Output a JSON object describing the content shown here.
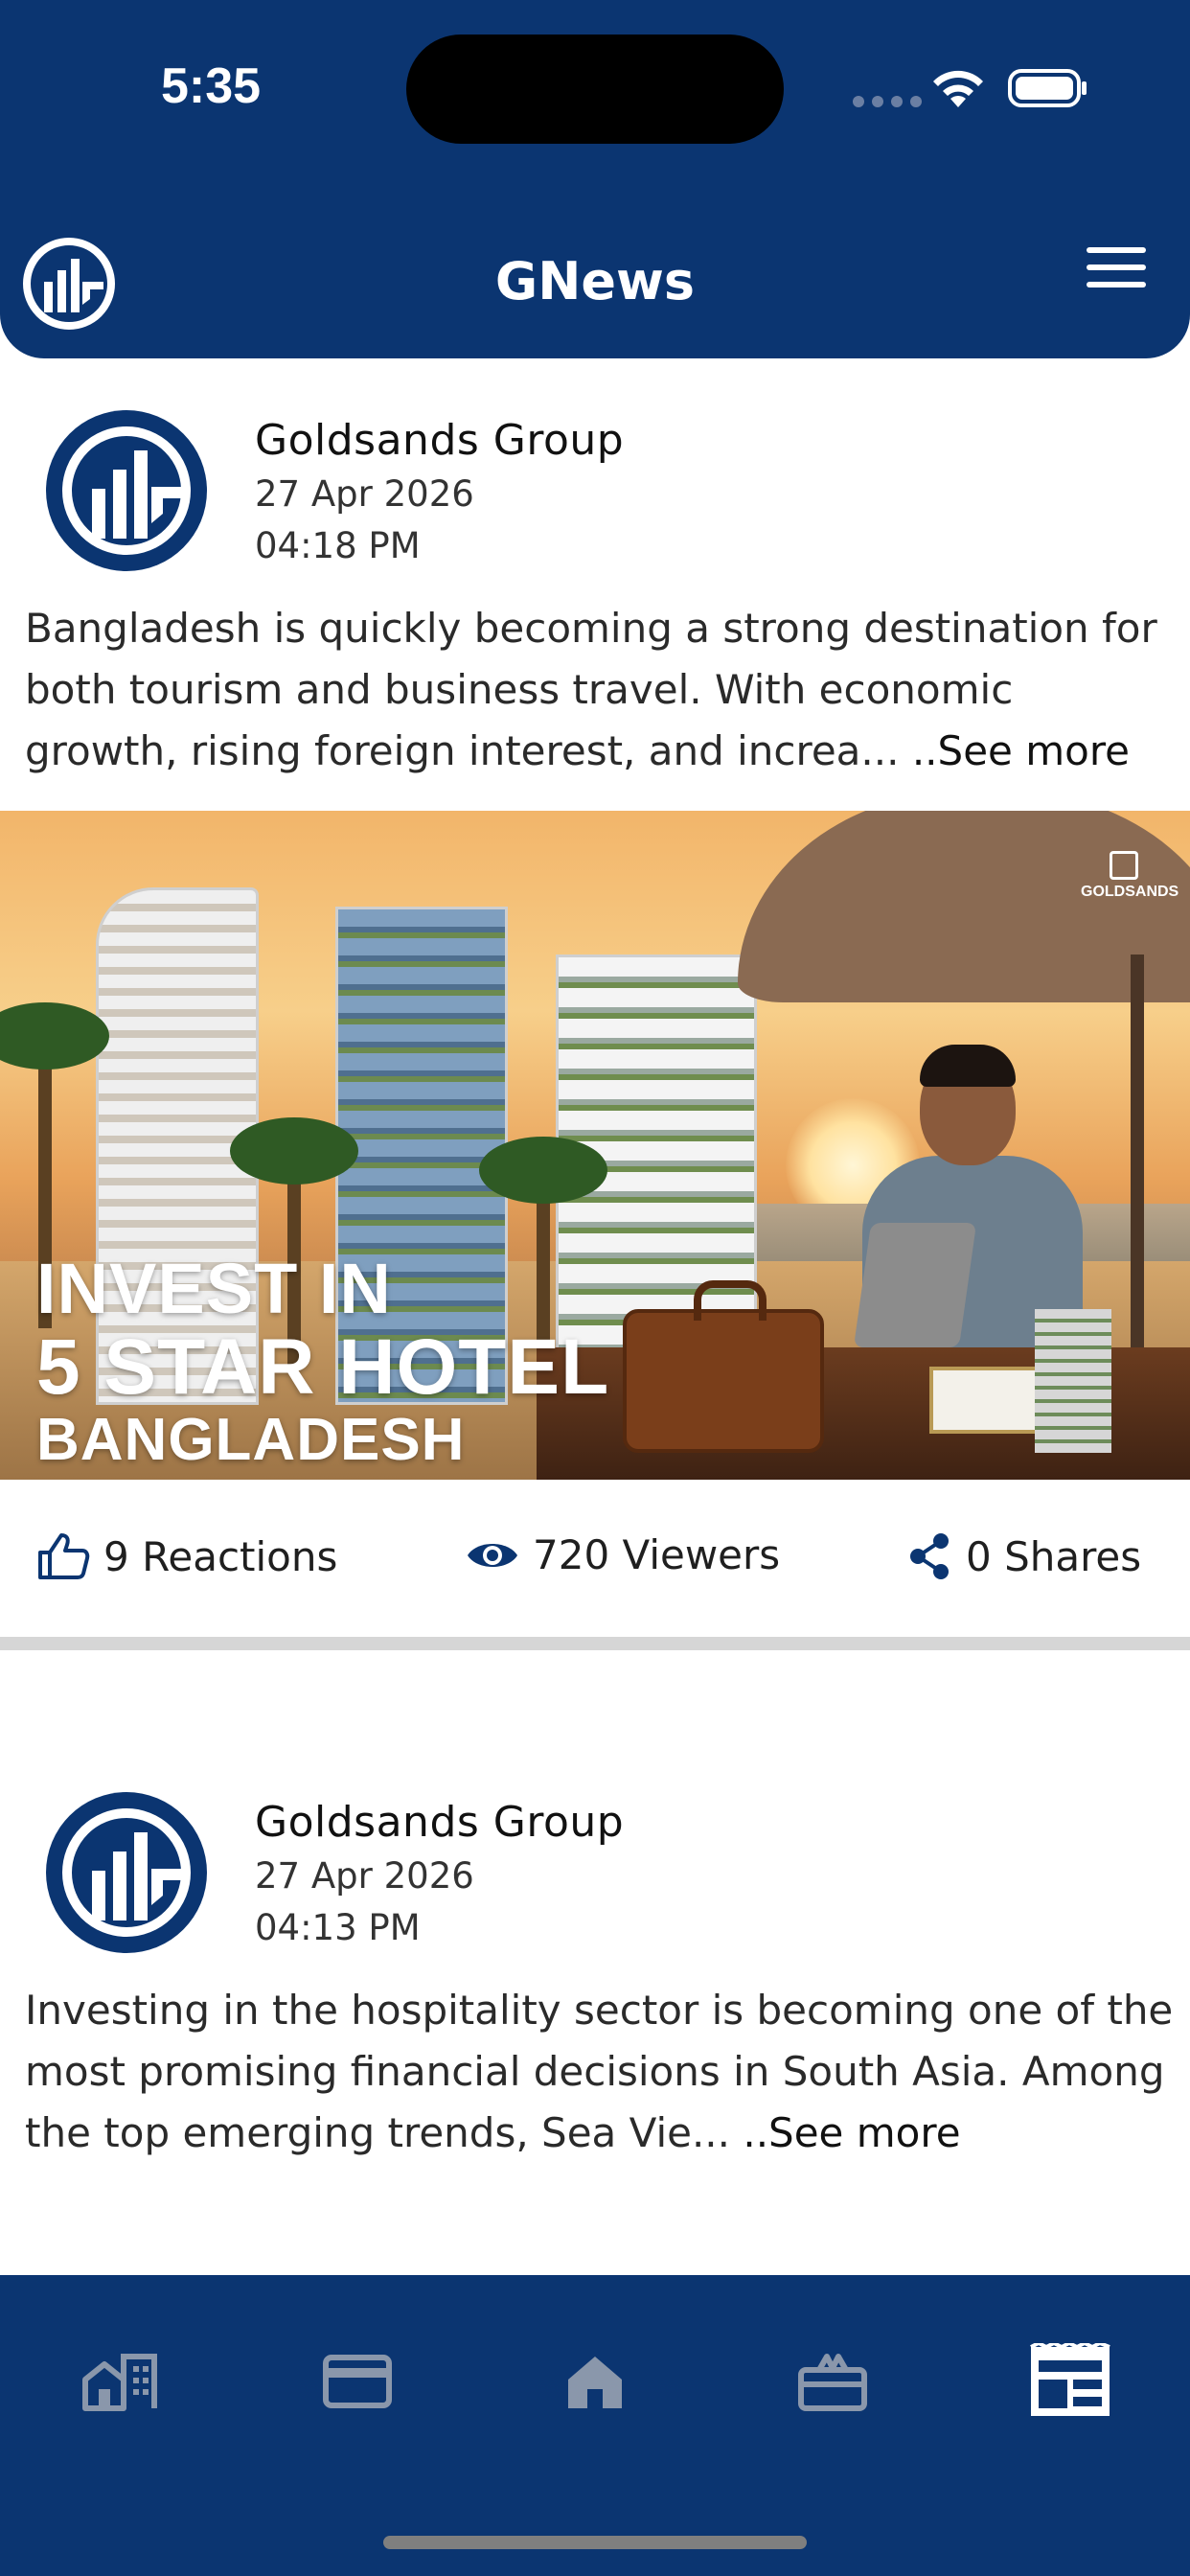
{
  "status_bar": {
    "time": "5:35"
  },
  "header": {
    "title": "GNews"
  },
  "posts": [
    {
      "author": "Goldsands Group",
      "date": "27 Apr 2026",
      "time": "04:18 PM",
      "text": "Bangladesh is quickly becoming a strong destination for both tourism and business travel. With economic growth, rising foreign interest, and increa... ",
      "see_more": "..See more",
      "banner": {
        "headline_line1": "INVEST IN",
        "headline_line2": "5 STAR HOTEL",
        "headline_line3": "BANGLADESH",
        "brand": "GOLDSANDS"
      },
      "stats": {
        "reactions": "9 Reactions",
        "viewers": "720 Viewers",
        "shares": "0 Shares"
      }
    },
    {
      "author": "Goldsands Group",
      "date": "27 Apr 2026",
      "time": "04:13 PM",
      "text": "Investing in the hospitality sector is becoming one of the most promising financial decisions in South Asia. Among the top emerging trends, Sea Vie... ",
      "see_more": "..See more"
    }
  ],
  "bottom_nav": {
    "items": [
      {
        "icon": "buildings-icon",
        "active": false
      },
      {
        "icon": "card-icon",
        "active": false
      },
      {
        "icon": "home-icon",
        "active": false
      },
      {
        "icon": "gift-icon",
        "active": false
      },
      {
        "icon": "news-icon",
        "active": true
      }
    ]
  },
  "colors": {
    "primary": "#0b3571",
    "nav_inactive": "#8a97ab",
    "nav_active": "#ffffff"
  }
}
